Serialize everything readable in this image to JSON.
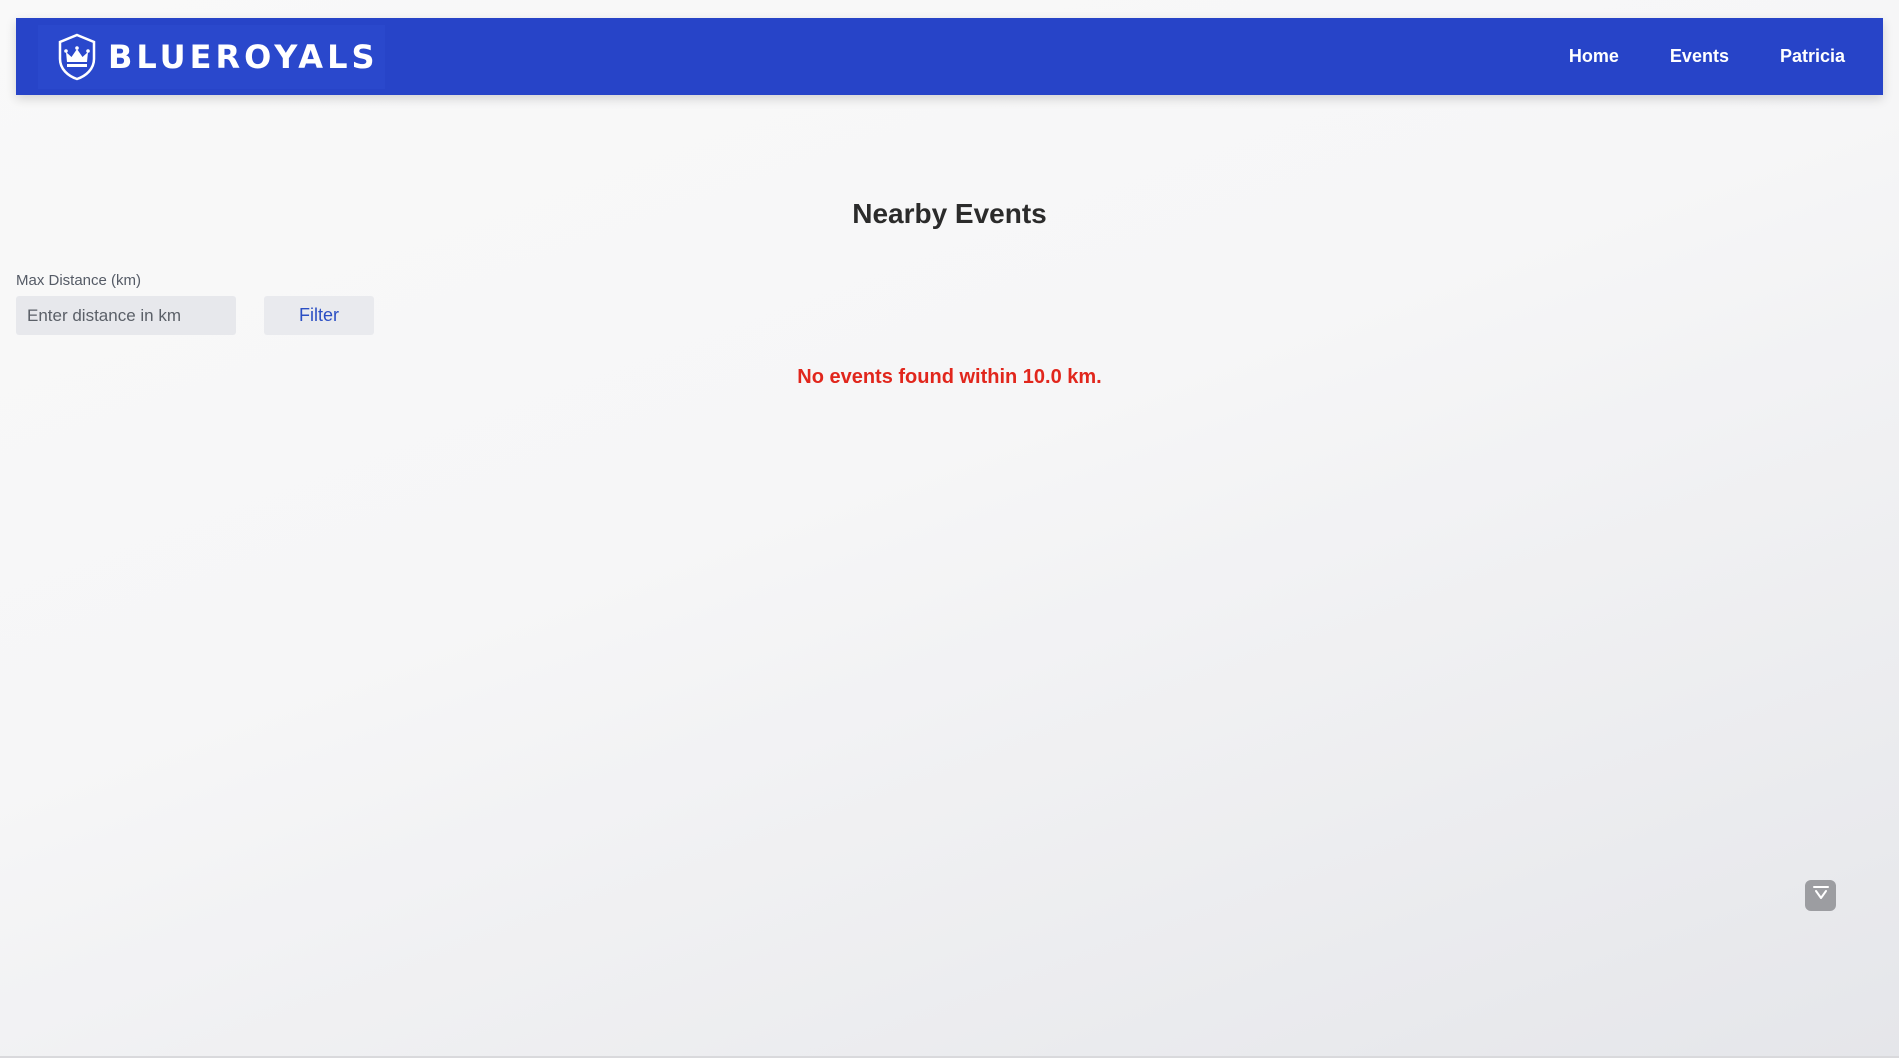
{
  "header": {
    "brand": "BLUEROYALS",
    "logo_icon": "crown-shield-icon",
    "nav": [
      {
        "label": "Home"
      },
      {
        "label": "Events"
      },
      {
        "label": "Patricia"
      }
    ]
  },
  "main": {
    "title": "Nearby Events",
    "filter": {
      "label": "Max Distance (km)",
      "placeholder": "Enter distance in km",
      "value": "",
      "button_label": "Filter"
    },
    "empty_message": "No events found within 10.0 km."
  },
  "widget": {
    "icon": "chevron-down-tray-icon"
  },
  "colors": {
    "header_bg": "#2744c8",
    "error_text": "#e1261c",
    "button_text": "#2b4fc4"
  }
}
